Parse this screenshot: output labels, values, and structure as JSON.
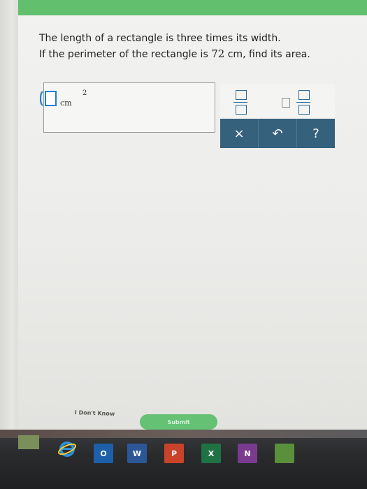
{
  "question": {
    "line1": "The length of a rectangle is three times its width.",
    "line2_prefix": "If the perimeter of the rectangle is ",
    "line2_number": "72",
    "line2_suffix": " cm, find its area."
  },
  "answer": {
    "unit": "cm",
    "exponent": "2"
  },
  "toolbar": {
    "clear_label": "×",
    "undo_label": "↶",
    "help_label": "?"
  },
  "actions": {
    "dont_know_label": "I Don't Know",
    "submit_label": "Submit"
  },
  "taskbar": {
    "outlook_label": "O",
    "word_label": "W",
    "powerpoint_label": "P",
    "excel_label": "X",
    "onenote_label": "N"
  },
  "colors": {
    "accent_green": "#62bf6e",
    "toolbar_blue": "#36617d",
    "input_focus_blue": "#1f7fd1"
  }
}
